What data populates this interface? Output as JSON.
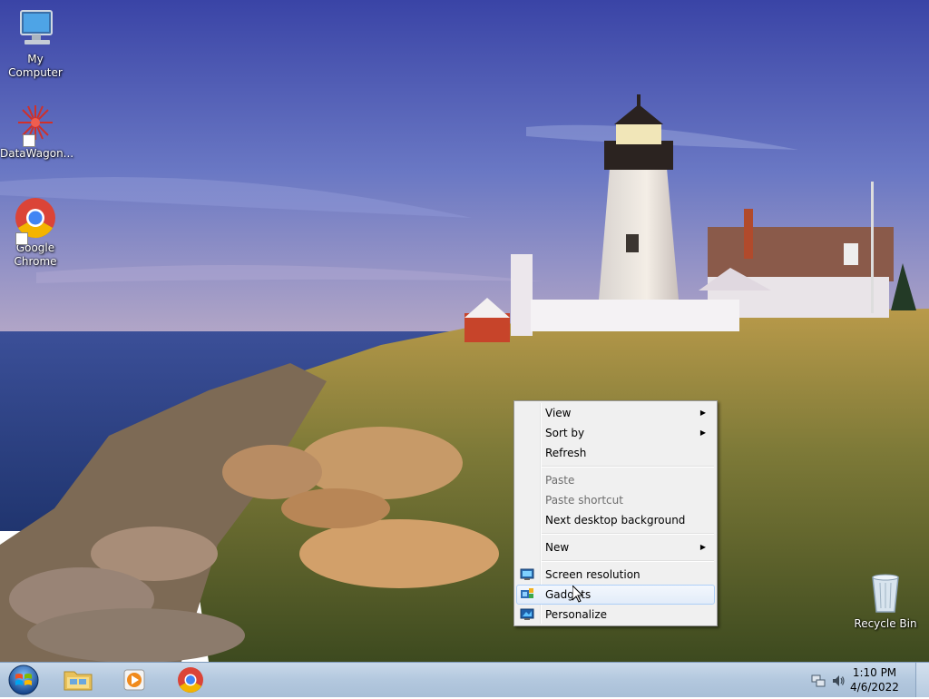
{
  "desktop": {
    "icons": [
      {
        "label": "My Computer"
      },
      {
        "label": "DataWagon..."
      },
      {
        "label": "Google Chrome"
      },
      {
        "label": "Recycle Bin"
      }
    ]
  },
  "context_menu": {
    "items": [
      {
        "label": "View",
        "submenu": true,
        "enabled": true
      },
      {
        "label": "Sort by",
        "submenu": true,
        "enabled": true
      },
      {
        "label": "Refresh",
        "enabled": true
      },
      {
        "label": "Paste",
        "enabled": false
      },
      {
        "label": "Paste shortcut",
        "enabled": false
      },
      {
        "label": "Next desktop background",
        "enabled": true
      },
      {
        "label": "New",
        "submenu": true,
        "enabled": true
      },
      {
        "label": "Screen resolution",
        "icon": "screen-resolution-icon",
        "enabled": true
      },
      {
        "label": "Gadgets",
        "icon": "gadgets-icon",
        "enabled": true,
        "hovered": true
      },
      {
        "label": "Personalize",
        "icon": "personalize-icon",
        "enabled": true
      }
    ],
    "arrow_glyph": "▶"
  },
  "taskbar": {
    "pinned": [
      "windows-explorer-icon",
      "media-player-icon",
      "chrome-icon"
    ],
    "clock": {
      "time": "1:10 PM",
      "date": "4/6/2022"
    },
    "tray_icons": [
      "network-icon",
      "volume-icon"
    ]
  },
  "colors": {
    "taskbar": "#b3c8de",
    "menu_bg": "#f0f0f0",
    "menu_hover": "#e2ecf9",
    "sky": "#3d4fa8",
    "sea": "#2f4a8f"
  }
}
